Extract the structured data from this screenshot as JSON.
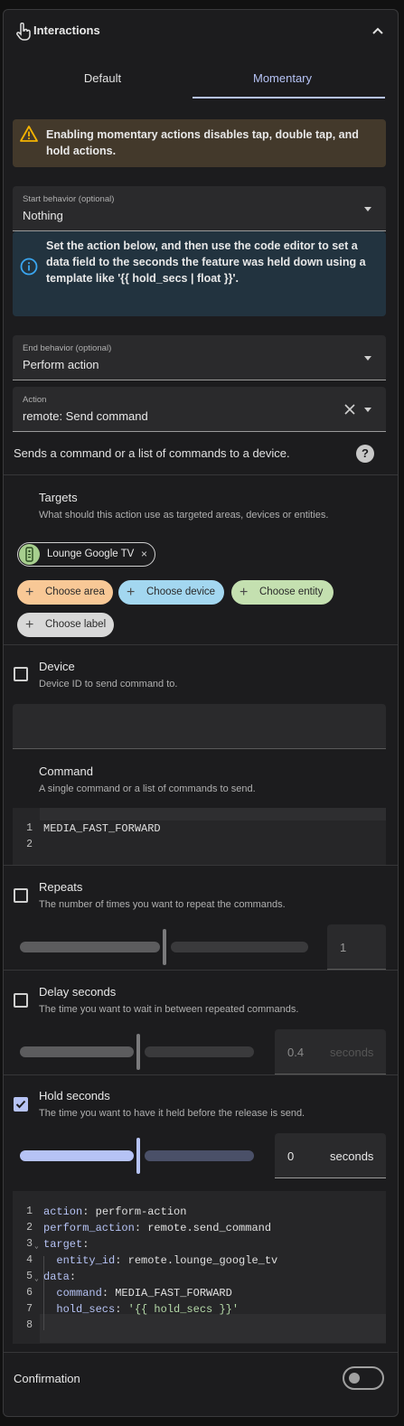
{
  "header": {
    "title": "Interactions",
    "icon": "hand-pointer-icon",
    "collapse_icon": "chevron-up-icon"
  },
  "tabs": [
    {
      "label": "Default",
      "active": false
    },
    {
      "label": "Momentary",
      "active": true
    }
  ],
  "warning": {
    "text": "Enabling momentary actions disables tap, double tap, and hold actions.",
    "icon": "warning-icon",
    "color": "#f5b301"
  },
  "start_behavior": {
    "label": "Start behavior (optional)",
    "value": "Nothing"
  },
  "info": {
    "text": "Set the action below, and then use the code editor to set a data field to the seconds the feature was held down using a template like '{{ hold_secs | float }}'.",
    "icon": "info-icon",
    "color": "#3aa6f0"
  },
  "end_behavior": {
    "label": "End behavior (optional)",
    "value": "Perform action"
  },
  "action": {
    "label": "Action",
    "value": "remote: Send command",
    "description": "Sends a command or a list of commands to a device.",
    "help_icon": "?"
  },
  "targets": {
    "title": "Targets",
    "subtitle": "What should this action use as targeted areas, devices or entities.",
    "selected": {
      "label": "Lounge Google TV",
      "remove": "×"
    },
    "chips": {
      "area": "Choose area",
      "device": "Choose device",
      "entity": "Choose entity",
      "label": "Choose label"
    },
    "plus": "+"
  },
  "device": {
    "title": "Device",
    "subtitle": "Device ID to send command to.",
    "checked": false,
    "value": ""
  },
  "command": {
    "title": "Command",
    "subtitle": "A single command or a list of commands to send.",
    "lines": [
      {
        "n": "1",
        "text": "MEDIA_FAST_FORWARD"
      },
      {
        "n": "2",
        "text": ""
      }
    ]
  },
  "repeats": {
    "title": "Repeats",
    "subtitle": "The number of times you want to repeat the commands.",
    "checked": false,
    "value": "1",
    "fraction": 0.5
  },
  "delay": {
    "title": "Delay seconds",
    "subtitle": "The time you want to wait in between repeated commands.",
    "checked": false,
    "value": "0.4",
    "unit": "seconds",
    "fraction": 0.5
  },
  "hold": {
    "title": "Hold seconds",
    "subtitle": "The time you want to have it held before the release is send.",
    "checked": true,
    "value": "0",
    "unit": "seconds",
    "fraction": 0.5
  },
  "yaml": {
    "lines": [
      {
        "n": "1",
        "k": "action",
        "v": " perform-action"
      },
      {
        "n": "2",
        "k": "perform_action",
        "v": " remote.send_command"
      },
      {
        "n": "3",
        "k": "target",
        "v": ""
      },
      {
        "n": "4",
        "k": "  entity_id",
        "v": " remote.lounge_google_tv"
      },
      {
        "n": "5",
        "k": "data",
        "v": ""
      },
      {
        "n": "6",
        "k": "  command",
        "v": " MEDIA_FAST_FORWARD"
      },
      {
        "n": "7",
        "k": "  hold_secs",
        "v": " '{{ hold_secs }}'"
      },
      {
        "n": "8",
        "k": "",
        "v": ""
      }
    ],
    "fold": "⌄"
  },
  "confirmation": {
    "label": "Confirmation",
    "enabled": false
  },
  "colors": {
    "accent": "#b6c3f5",
    "background": "#1c1c1e"
  }
}
